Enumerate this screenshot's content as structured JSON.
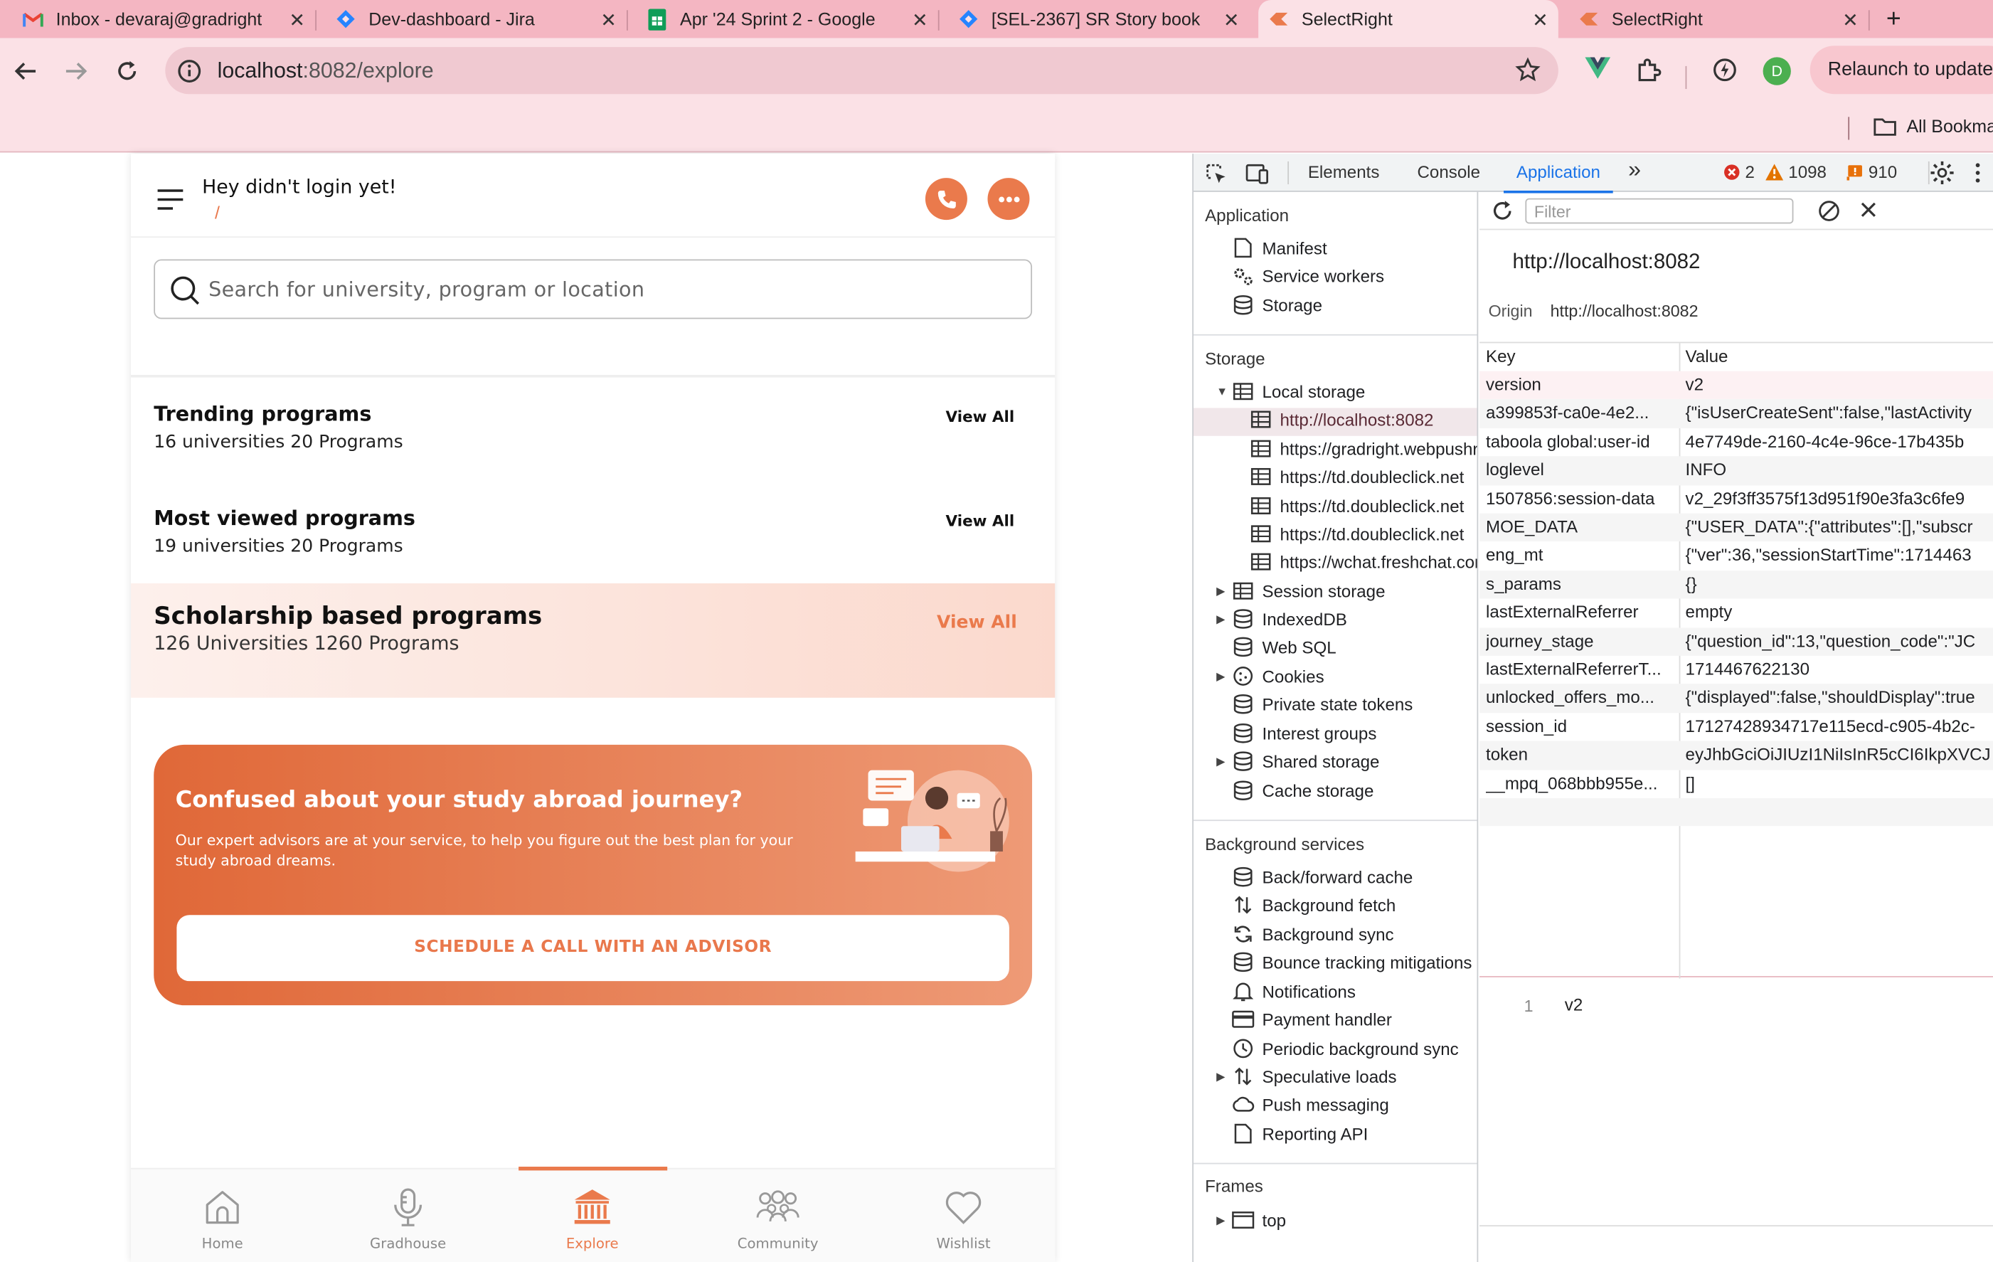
{
  "browser": {
    "tabs": [
      {
        "title": "Inbox - devaraj@gradright",
        "icon": "gmail-icon",
        "active": false
      },
      {
        "title": "Dev-dashboard - Jira",
        "icon": "jira-icon",
        "active": false
      },
      {
        "title": "Apr '24 Sprint 2 - Google",
        "icon": "sheets-icon",
        "active": false
      },
      {
        "title": "[SEL-2367] SR Story book",
        "icon": "jira-icon",
        "active": false
      },
      {
        "title": "SelectRight",
        "icon": "selectright-icon",
        "active": true
      },
      {
        "title": "SelectRight",
        "icon": "selectright-icon",
        "active": false
      }
    ],
    "new_tab": "+",
    "url_host": "localhost",
    "url_path": ":8082/explore",
    "relaunch_label": "Relaunch to update",
    "profile_initial": "D",
    "all_bookmarks": "All Bookmarks"
  },
  "app": {
    "greeting": "Hey didn't login yet!",
    "greeting_sub": "/",
    "search_placeholder": "Search for university, program or location",
    "sections": [
      {
        "title": "Trending programs",
        "subtitle": "16 universities 20 Programs",
        "view_all": "View All"
      },
      {
        "title": "Most viewed programs",
        "subtitle": "19 universities 20 Programs",
        "view_all": "View All"
      }
    ],
    "scholarship": {
      "title": "Scholarship based programs",
      "subtitle": "126 Universities 1260 Programs",
      "view_all": "View All"
    },
    "banner": {
      "title": "Confused about your study abroad journey?",
      "description": "Our expert advisors are at your service, to help you figure out the best plan for your study abroad dreams.",
      "cta": "SCHEDULE A CALL WITH AN ADVISOR"
    },
    "nav": [
      {
        "label": "Home",
        "icon": "home-icon",
        "active": false
      },
      {
        "label": "Gradhouse",
        "icon": "microphone-icon",
        "active": false
      },
      {
        "label": "Explore",
        "icon": "bank-icon",
        "active": true
      },
      {
        "label": "Community",
        "icon": "community-icon",
        "active": false
      },
      {
        "label": "Wishlist",
        "icon": "heart-icon",
        "active": false
      }
    ],
    "accent": "#ea7a4c"
  },
  "devtools": {
    "tabs": [
      "Elements",
      "Console",
      "Application"
    ],
    "active_tab": "Application",
    "more": "»",
    "errors": "2",
    "warnings": "1098",
    "issues": "910",
    "filter_placeholder": "Filter",
    "sidebar": {
      "application_header": "Application",
      "application_items": [
        "Manifest",
        "Service workers",
        "Storage"
      ],
      "storage_header": "Storage",
      "local_storage": "Local storage",
      "local_storage_items": [
        "http://localhost:8082",
        "https://gradright.webpushr.com",
        "https://td.doubleclick.net",
        "https://td.doubleclick.net",
        "https://td.doubleclick.net",
        "https://wchat.freshchat.com"
      ],
      "storage_items": [
        "Session storage",
        "IndexedDB",
        "Web SQL",
        "Cookies",
        "Private state tokens",
        "Interest groups",
        "Shared storage",
        "Cache storage"
      ],
      "bg_header": "Background services",
      "bg_items": [
        "Back/forward cache",
        "Background fetch",
        "Background sync",
        "Bounce tracking mitigations",
        "Notifications",
        "Payment handler",
        "Periodic background sync",
        "Speculative loads",
        "Push messaging",
        "Reporting API"
      ],
      "frames_header": "Frames",
      "frames_items": [
        "top"
      ]
    },
    "origin_heading": "http://localhost:8082",
    "origin_label": "Origin",
    "origin_value": "http://localhost:8082",
    "table": {
      "headers": [
        "Key",
        "Value"
      ],
      "rows": [
        [
          "version",
          "v2"
        ],
        [
          "a399853f-ca0e-4e2...",
          "{\"isUserCreateSent\":false,\"lastActivity"
        ],
        [
          "taboola global:user-id",
          "4e7749de-2160-4c4e-96ce-17b435b"
        ],
        [
          "loglevel",
          "INFO"
        ],
        [
          "1507856:session-data",
          "v2_29f3ff3575f13d951f90e3fa3c6fe9"
        ],
        [
          "MOE_DATA",
          "{\"USER_DATA\":{\"attributes\":[],\"subscr"
        ],
        [
          "eng_mt",
          "{\"ver\":36,\"sessionStartTime\":1714463"
        ],
        [
          "s_params",
          "{}"
        ],
        [
          "lastExternalReferrer",
          "empty"
        ],
        [
          "journey_stage",
          "{\"question_id\":13,\"question_code\":\"JC"
        ],
        [
          "lastExternalReferrerT...",
          "1714467622130"
        ],
        [
          "unlocked_offers_mo...",
          "{\"displayed\":false,\"shouldDisplay\":true"
        ],
        [
          "session_id",
          "17127428934717e115ecd-c905-4b2c-"
        ],
        [
          "token",
          "eyJhbGciOiJIUzI1NiIsInR5cCI6IkpXVCJ"
        ],
        [
          "__mpq_068bbb955e...",
          "[]"
        ]
      ]
    },
    "preview_line": "1",
    "preview_value": "v2"
  }
}
